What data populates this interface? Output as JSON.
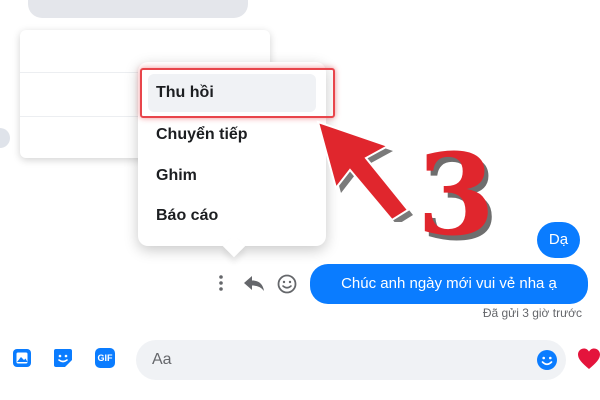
{
  "menu": {
    "items": [
      {
        "label": "Thu hồi",
        "active": true
      },
      {
        "label": "Chuyển tiếp",
        "active": false
      },
      {
        "label": "Ghim",
        "active": false
      },
      {
        "label": "Báo cáo",
        "active": false
      }
    ]
  },
  "annotation": {
    "step": "3"
  },
  "messages": [
    {
      "text": "Dạ"
    },
    {
      "text": "Chúc anh ngày mới vui vẻ nha ạ"
    }
  ],
  "status": "Đã gửi 3 giờ trước",
  "composer": {
    "placeholder": "Aa",
    "gif_label": "GIF",
    "icons": [
      "image-icon",
      "sticker-icon",
      "gif-icon",
      "emoji-icon",
      "heart-icon"
    ]
  },
  "message_actions": [
    "more-options-icon",
    "forward-icon",
    "react-icon"
  ],
  "colors": {
    "bubble": "#0a7cff",
    "highlight": "#e8454b",
    "annotation": "#e0262d",
    "heart": "#e4143c"
  }
}
